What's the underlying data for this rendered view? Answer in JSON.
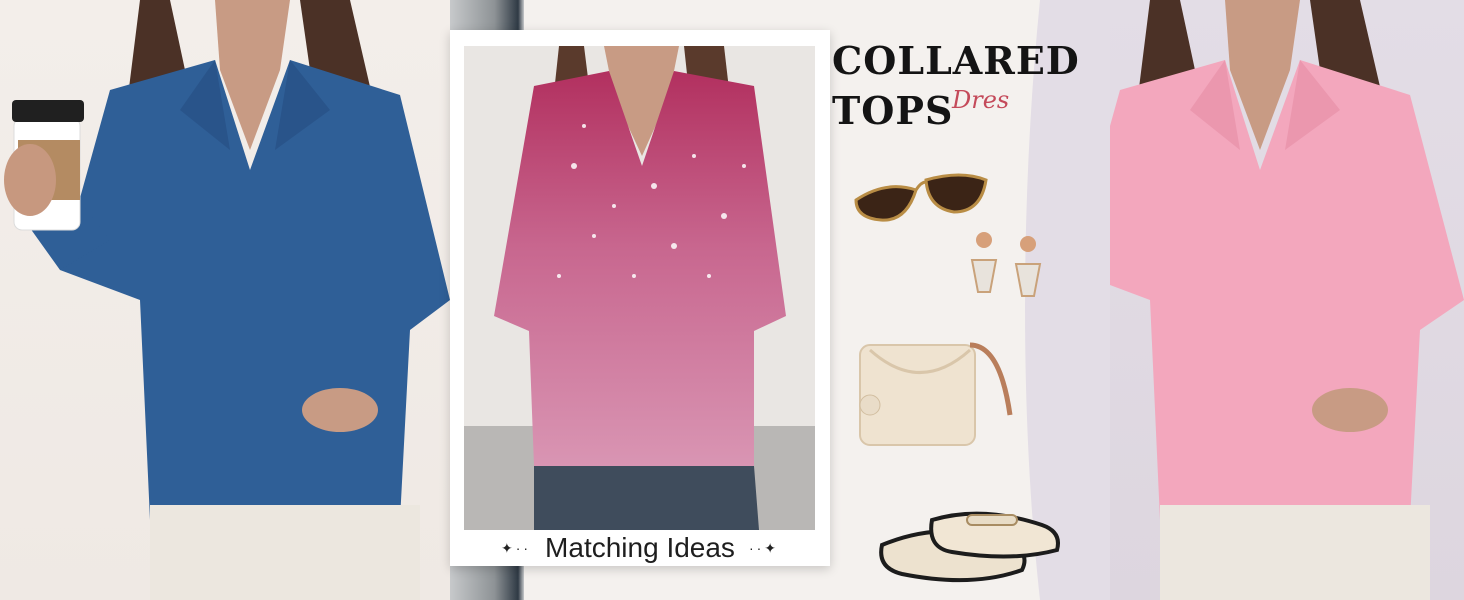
{
  "caption": {
    "text": "Matching Ideas",
    "left_sparkle": "✦··",
    "right_sparkle": "··✦"
  },
  "headline": {
    "line1": "COLLARED",
    "line2": "TOPS",
    "script": "Dres"
  },
  "colors": {
    "blue_top": "#2f5f97",
    "pink_top": "#f3a7bd",
    "printed_top": "#b2305f",
    "script_accent": "#c44a5a"
  },
  "accessories": [
    "sunglasses-icon",
    "earrings-icon",
    "straw-bag-icon",
    "mary-jane-shoes-icon"
  ]
}
